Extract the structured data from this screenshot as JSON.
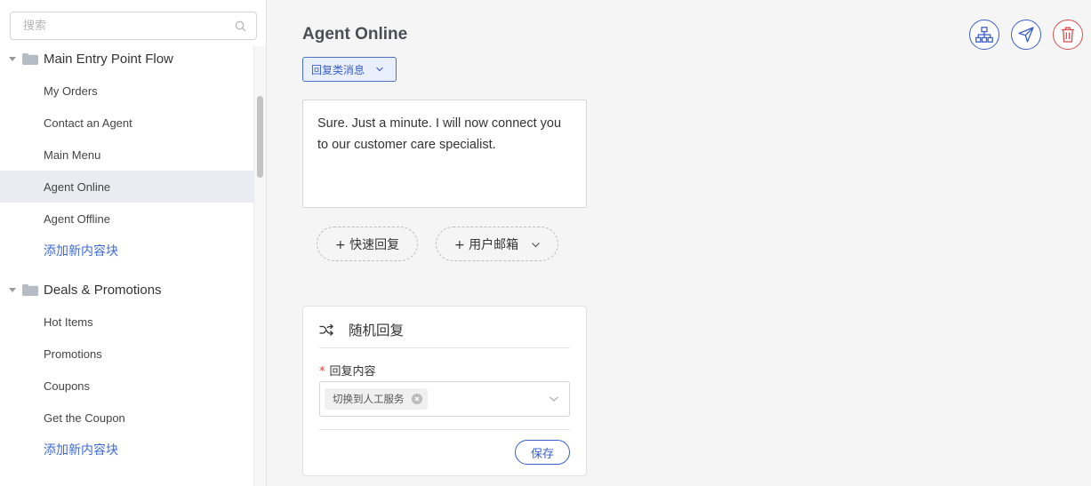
{
  "sidebar": {
    "search": {
      "placeholder": "搜索",
      "value": ""
    },
    "groups": [
      {
        "label": "Main Entry Point Flow",
        "items": [
          "My Orders",
          "Contact an Agent",
          "Main Menu",
          "Agent Online",
          "Agent Offline"
        ],
        "add_label": "添加新内容块"
      },
      {
        "label": "Deals & Promotions",
        "items": [
          "Hot Items",
          "Promotions",
          "Coupons",
          "Get the Coupon"
        ],
        "add_label": "添加新内容块"
      }
    ],
    "active_item": "Agent Online"
  },
  "main": {
    "title": "Agent Online",
    "type_select": "回复类消息",
    "message": "Sure.  Just a minute. I will now connect you to our customer care specialist.",
    "quick_reply_label": "+ 快速回复",
    "user_email_label": "+ 用户邮箱",
    "card": {
      "title": "随机回复",
      "required_mark": "*",
      "field_label": "回复内容",
      "tag": "切换到人工服务",
      "save_label": "保存"
    }
  },
  "icons": {
    "header_actions": [
      "sitemap-icon",
      "send-icon",
      "trash-icon"
    ]
  },
  "colors": {
    "accent": "#3b5fc9",
    "danger": "#d84c4c",
    "link": "#3b6ad6",
    "active_row": "#e9edf2"
  }
}
